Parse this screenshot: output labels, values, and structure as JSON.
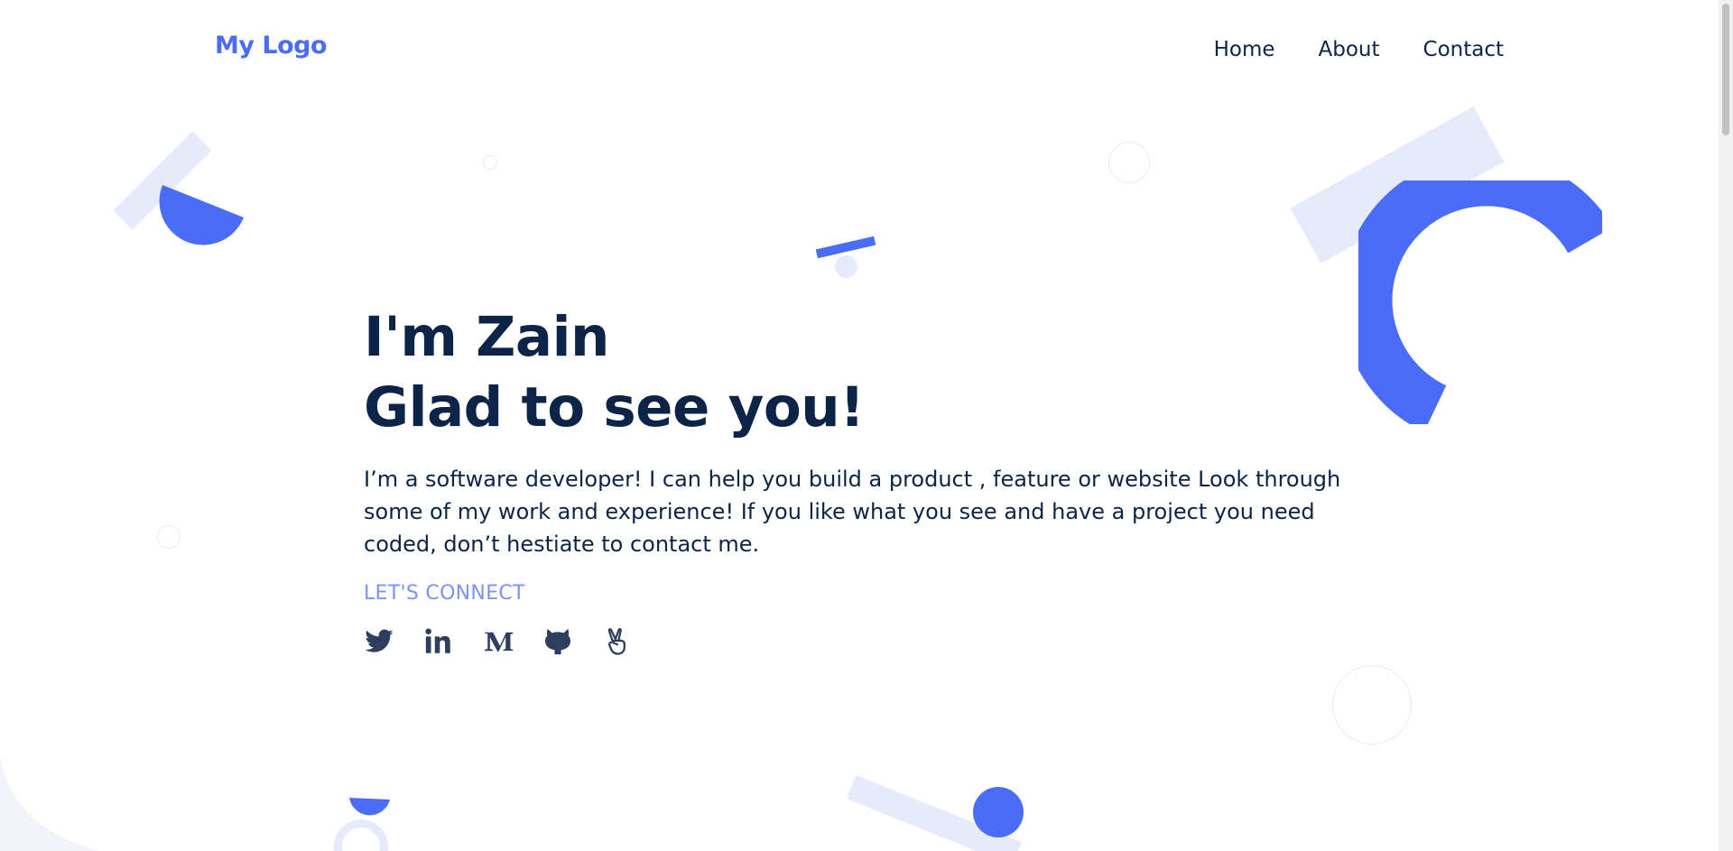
{
  "header": {
    "logo": "My Logo",
    "nav": [
      {
        "label": "Home"
      },
      {
        "label": "About"
      },
      {
        "label": "Contact"
      }
    ]
  },
  "hero": {
    "title_line1": "I'm Zain",
    "title_line2": "Glad to see you!",
    "description": "I’m a software developer! I can help you build a product , feature or website Look through some of my work and experience! If you like what you see and have a project you need coded, don’t hestiate to contact me.",
    "connect_label": "LET'S CONNECT",
    "socials": [
      {
        "icon": "twitter-icon"
      },
      {
        "icon": "linkedin-icon"
      },
      {
        "icon": "medium-icon"
      },
      {
        "icon": "github-icon"
      },
      {
        "icon": "angellist-icon"
      }
    ]
  },
  "colors": {
    "primary": "#4a6cf7",
    "primary_light": "#e7e9fd",
    "heading": "#0b2447",
    "connect": "#7b93f7",
    "icon": "#2d3e5e"
  }
}
